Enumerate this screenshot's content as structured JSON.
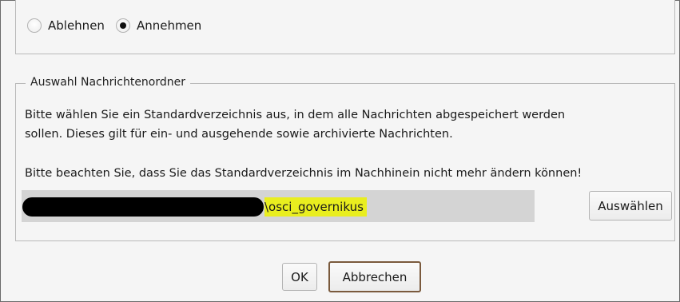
{
  "acceptance": {
    "options": [
      {
        "label": "Ablehnen",
        "checked": false
      },
      {
        "label": "Annehmen",
        "checked": true
      }
    ]
  },
  "folder_group": {
    "legend": "Auswahl Nachrichtenordner",
    "description_line1": "Bitte wählen Sie ein Standardverzeichnis aus, in dem alle Nachrichten abgespeichert werden",
    "description_line2": "sollen. Dieses gilt für ein- und ausgehende sowie archivierte Nachrichten.",
    "warning": "Bitte beachten Sie, dass Sie das Standardverzeichnis im Nachhinein nicht mehr ändern können!",
    "path_value": "\\osci_governikus",
    "choose_label": "Auswählen"
  },
  "dialog": {
    "ok_label": "OK",
    "cancel_label": "Abbrechen"
  },
  "colors": {
    "highlight": "#e9ee1f",
    "cancel_border": "#7a5a3d",
    "path_bar": "#d4d4d4"
  }
}
